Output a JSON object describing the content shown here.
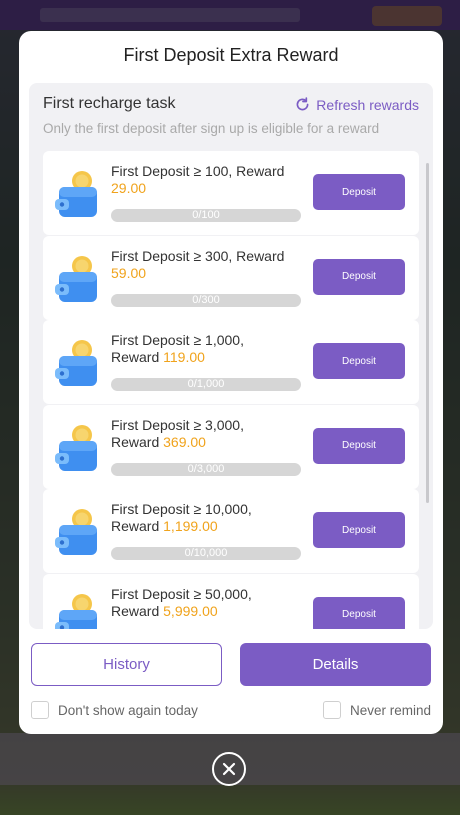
{
  "modal": {
    "title": "First Deposit Extra Reward",
    "task_heading": "First recharge task",
    "refresh_label": "Refresh rewards",
    "note": "Only the first deposit after sign up is eligible for a reward",
    "tasks": [
      {
        "line1": "First Deposit ≥ 100, Reward",
        "line2": "",
        "amount": "29.00",
        "progress": "0/100",
        "button": "Deposit"
      },
      {
        "line1": "First Deposit ≥ 300, Reward",
        "line2": "",
        "amount": "59.00",
        "progress": "0/300",
        "button": "Deposit"
      },
      {
        "line1": "First Deposit ≥ 1,000,",
        "line2": "Reward ",
        "amount": "119.00",
        "progress": "0/1,000",
        "button": "Deposit"
      },
      {
        "line1": "First Deposit ≥ 3,000,",
        "line2": "Reward ",
        "amount": "369.00",
        "progress": "0/3,000",
        "button": "Deposit"
      },
      {
        "line1": "First Deposit ≥ 10,000,",
        "line2": "Reward ",
        "amount": "1,199.00",
        "progress": "0/10,000",
        "button": "Deposit"
      },
      {
        "line1": "First Deposit ≥ 50,000,",
        "line2": "Reward ",
        "amount": "5,999.00",
        "progress": "",
        "button": "Deposit"
      }
    ],
    "history_label": "History",
    "details_label": "Details",
    "dont_show_label": "Don't show again today",
    "never_remind_label": "Never remind"
  },
  "colors": {
    "accent": "#7b5cc4",
    "reward_amount": "#f0a31c"
  },
  "icons": {
    "refresh": "refresh-icon",
    "wallet": "wallet-coin-icon",
    "close": "close-icon"
  }
}
